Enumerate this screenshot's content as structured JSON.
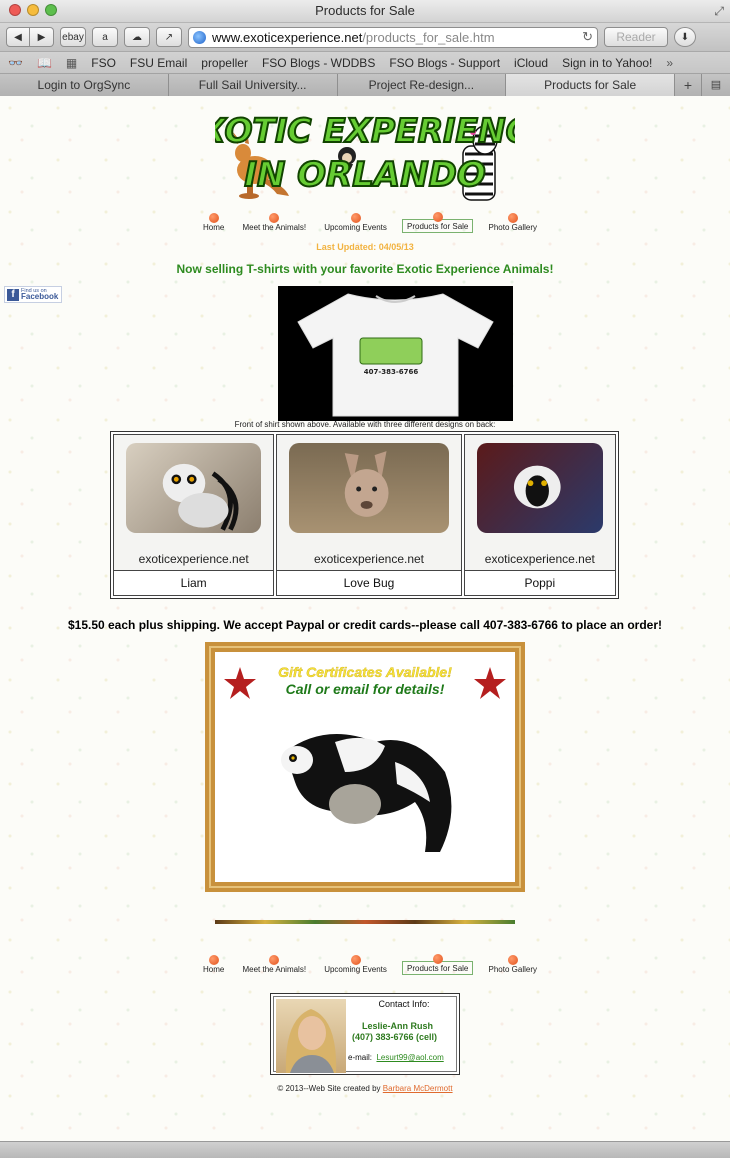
{
  "window": {
    "title": "Products for Sale"
  },
  "toolbar": {
    "ebay_label": "ebay",
    "url_host": "www.exoticexperience.net",
    "url_path": "/products_for_sale.htm",
    "reader_label": "Reader"
  },
  "bookmarks": [
    "FSO",
    "FSU Email",
    "propeller",
    "FSO Blogs - WDDBS",
    "FSO Blogs - Support",
    "iCloud",
    "Sign in to Yahoo!"
  ],
  "tabs": [
    {
      "label": "Login to OrgSync",
      "active": false
    },
    {
      "label": "Full Sail University...",
      "active": false
    },
    {
      "label": "Project Re-design...",
      "active": false
    },
    {
      "label": "Products for Sale",
      "active": true
    }
  ],
  "logo": {
    "line1": "EXOTIC EXPERIENCE",
    "line2": "IN ORLANDO"
  },
  "nav": {
    "items": [
      {
        "label": "Home",
        "current": false
      },
      {
        "label": "Meet the Animals!",
        "current": false
      },
      {
        "label": "Upcoming Events",
        "current": false
      },
      {
        "label": "Products for Sale",
        "current": true
      },
      {
        "label": "Photo Gallery",
        "current": false
      }
    ]
  },
  "updated": "Last Updated:  04/05/13",
  "headline": "Now selling T-shirts with your favorite Exotic Experience Animals!",
  "facebook": {
    "small": "Find us on",
    "big": "Facebook"
  },
  "shirt": {
    "phone": "407-383-6766"
  },
  "caption": "Front of shirt shown above.  Available with three different designs on back:",
  "products": [
    {
      "name": "Liam",
      "site": "exoticexperience.net"
    },
    {
      "name": "Love Bug",
      "site": "exoticexperience.net"
    },
    {
      "name": "Poppi",
      "site": "exoticexperience.net"
    }
  ],
  "price": "$15.50 each plus shipping. We accept Paypal or credit cards--please call 407-383-6766 to place an order!",
  "gift": {
    "line1": "Gift Certificates Available!",
    "line2": "Call or email for details!"
  },
  "contact": {
    "title": "Contact Info:",
    "name": "Leslie-Ann Rush",
    "phone": "(407) 383-6766 (cell)",
    "email_label": "e-mail:",
    "email": "Lesurt99@aol.com"
  },
  "credit": {
    "text": "© 2013--Web Site created by ",
    "author": "Barbara McDermott"
  },
  "colors": {
    "accent_green": "#2e8b20",
    "nav_dot": "#e2531d",
    "updated": "#f2b341",
    "frame": "#c8913c"
  }
}
